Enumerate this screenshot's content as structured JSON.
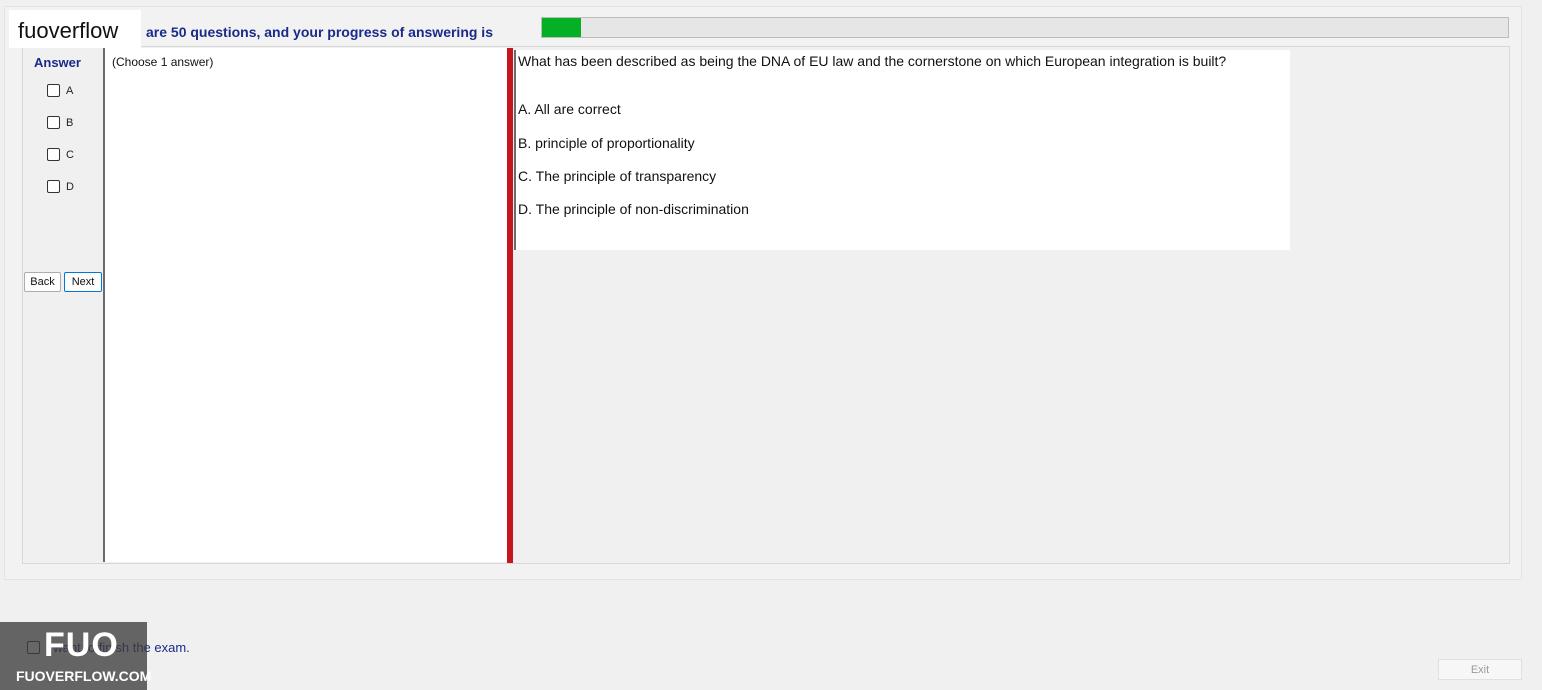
{
  "header": {
    "logo_text": "fuoverflow",
    "progress_text": "are 50 questions, and your progress of answering is",
    "progress_fraction": 0.04
  },
  "answer_panel": {
    "title": "Answer",
    "options": [
      "A",
      "B",
      "C",
      "D"
    ],
    "back_label": "Back",
    "next_label": "Next"
  },
  "note": {
    "text": "(Choose 1 answer)"
  },
  "question": {
    "text": "What has been described as being the DNA of EU law and the cornerstone on which European integration is built?",
    "options": [
      "A.  All are correct",
      "B.  principle of proportionality",
      "C.  The principle of transparency",
      "D.  The principle of non-discrimination"
    ]
  },
  "footer": {
    "finish_label": "I want to finish the exam.",
    "exit_label": "Exit",
    "watermark_big": "FUO",
    "watermark_small": "FUOVERFLOW.COM"
  },
  "colors": {
    "progress": "#06b025",
    "divider": "#c4161c",
    "title_blue": "#1a2a8a"
  }
}
